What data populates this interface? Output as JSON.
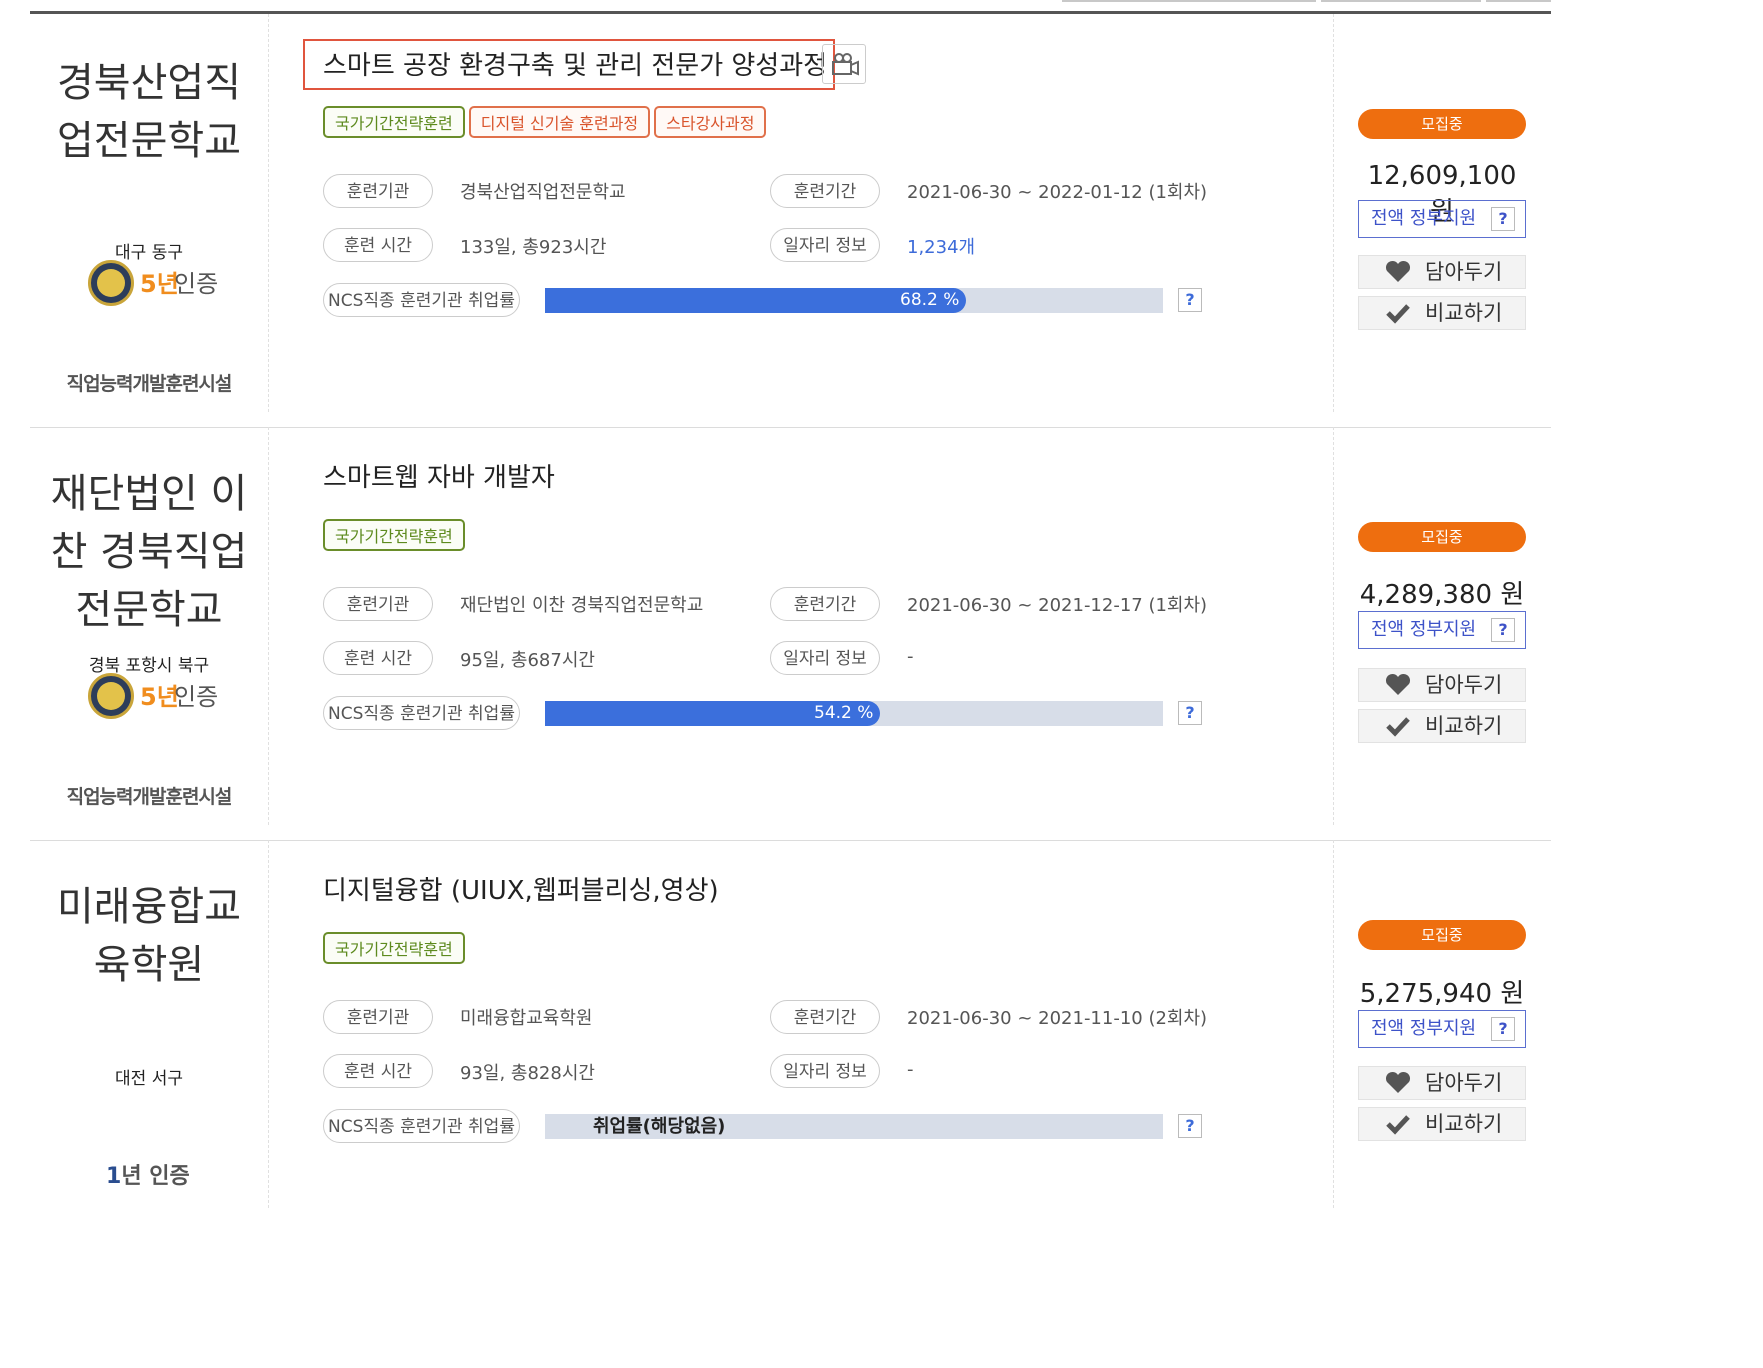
{
  "cards": [
    {
      "org_name": [
        "경북산업직",
        "업전문학교"
      ],
      "region": "대구 동구",
      "cert": {
        "years": "5년",
        "label": "인증"
      },
      "facility": "직업능력개발훈련시설",
      "title": "스마트 공장 환경구축 및 관리 전문가 양성과정",
      "tags": [
        "국가기간전략훈련",
        "디지털 신기술 훈련과정",
        "스타강사과정"
      ],
      "institution_label": "훈련기관",
      "institution": "경북산업직업전문학교",
      "period_label": "훈련기간",
      "period": "2021-06-30 ~ 2022-01-12 (1회차)",
      "hours_label": "훈련 시간",
      "hours": "133일, 총923시간",
      "jobs_label": "일자리 정보",
      "jobs": "1,234개",
      "rate_label": "NCS직종 훈련기관 취업률",
      "rate": 68.2,
      "rate_text": "68.2 %",
      "status": "모집중",
      "price": "12,609,100 원",
      "gov_support": "전액 정부지원",
      "help": "?",
      "wish_label": "담아두기",
      "compare_label": "비교하기"
    },
    {
      "org_name": [
        "재단법인 이",
        "찬 경북직업",
        "전문학교"
      ],
      "region": "경북 포항시 북구",
      "cert": {
        "years": "5년",
        "label": "인증"
      },
      "facility": "직업능력개발훈련시설",
      "title": "스마트웹 자바 개발자",
      "tags": [
        "국가기간전략훈련"
      ],
      "institution_label": "훈련기관",
      "institution": "재단법인 이찬 경북직업전문학교",
      "period_label": "훈련기간",
      "period": "2021-06-30 ~ 2021-12-17 (1회차)",
      "hours_label": "훈련 시간",
      "hours": "95일, 총687시간",
      "jobs_label": "일자리 정보",
      "jobs": "-",
      "rate_label": "NCS직종 훈련기관 취업률",
      "rate": 54.2,
      "rate_text": "54.2 %",
      "status": "모집중",
      "price": "4,289,380 원",
      "gov_support": "전액 정부지원",
      "help": "?",
      "wish_label": "담아두기",
      "compare_label": "비교하기"
    },
    {
      "org_name": [
        "미래융합교",
        "육학원"
      ],
      "region": "대전 서구",
      "cert1y": {
        "num": "1",
        "label": "년 인증"
      },
      "title": "디지털융합 (UIUX,웹퍼블리싱,영상)",
      "tags": [
        "국가기간전략훈련"
      ],
      "institution_label": "훈련기관",
      "institution": "미래융합교육학원",
      "period_label": "훈련기간",
      "period": "2021-06-30 ~ 2021-11-10 (2회차)",
      "hours_label": "훈련 시간",
      "hours": "93일, 총828시간",
      "jobs_label": "일자리 정보",
      "jobs": "-",
      "rate_label": "NCS직종 훈련기관 취업률",
      "rate_none": "취업률(해당없음)",
      "status": "모집중",
      "price": "5,275,940 원",
      "gov_support": "전액 정부지원",
      "help": "?",
      "wish_label": "담아두기",
      "compare_label": "비교하기"
    }
  ]
}
